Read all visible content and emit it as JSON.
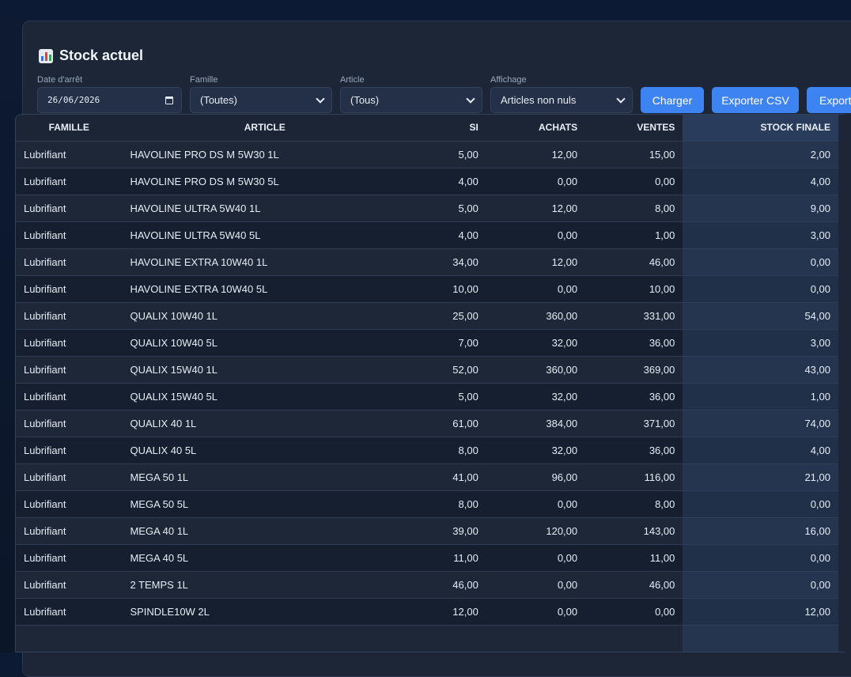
{
  "page": {
    "title": "Stock actuel",
    "title_icon": "bar-chart-icon"
  },
  "filters": {
    "date_label": "Date d'arrêt",
    "date_value": "26/06/2026",
    "famille_label": "Famille",
    "famille_value": "(Toutes)",
    "article_label": "Article",
    "article_value": "(Tous)",
    "affichage_label": "Affichage",
    "affichage_value": "Articles non nuls"
  },
  "buttons": {
    "charger": "Charger",
    "export_csv": "Exporter CSV",
    "export_other": "Exporte"
  },
  "colors": {
    "accent": "#3d84f2",
    "panel": "#1c2636",
    "highlight_column": "#25354f"
  },
  "table": {
    "headers": [
      "FAMILLE",
      "ARTICLE",
      "SI",
      "ACHATS",
      "VENTES",
      "STOCK FINALE"
    ],
    "rows": [
      [
        "Lubrifiant",
        "HAVOLINE PRO DS M 5W30 1L",
        "5,00",
        "12,00",
        "15,00",
        "2,00"
      ],
      [
        "Lubrifiant",
        "HAVOLINE PRO DS M 5W30 5L",
        "4,00",
        "0,00",
        "0,00",
        "4,00"
      ],
      [
        "Lubrifiant",
        "HAVOLINE ULTRA 5W40 1L",
        "5,00",
        "12,00",
        "8,00",
        "9,00"
      ],
      [
        "Lubrifiant",
        "HAVOLINE ULTRA 5W40 5L",
        "4,00",
        "0,00",
        "1,00",
        "3,00"
      ],
      [
        "Lubrifiant",
        "HAVOLINE EXTRA 10W40 1L",
        "34,00",
        "12,00",
        "46,00",
        "0,00"
      ],
      [
        "Lubrifiant",
        "HAVOLINE EXTRA 10W40 5L",
        "10,00",
        "0,00",
        "10,00",
        "0,00"
      ],
      [
        "Lubrifiant",
        "QUALIX 10W40 1L",
        "25,00",
        "360,00",
        "331,00",
        "54,00"
      ],
      [
        "Lubrifiant",
        "QUALIX 10W40 5L",
        "7,00",
        "32,00",
        "36,00",
        "3,00"
      ],
      [
        "Lubrifiant",
        "QUALIX 15W40 1L",
        "52,00",
        "360,00",
        "369,00",
        "43,00"
      ],
      [
        "Lubrifiant",
        "QUALIX 15W40 5L",
        "5,00",
        "32,00",
        "36,00",
        "1,00"
      ],
      [
        "Lubrifiant",
        "QUALIX 40 1L",
        "61,00",
        "384,00",
        "371,00",
        "74,00"
      ],
      [
        "Lubrifiant",
        "QUALIX 40 5L",
        "8,00",
        "32,00",
        "36,00",
        "4,00"
      ],
      [
        "Lubrifiant",
        "MEGA 50 1L",
        "41,00",
        "96,00",
        "116,00",
        "21,00"
      ],
      [
        "Lubrifiant",
        "MEGA 50 5L",
        "8,00",
        "0,00",
        "8,00",
        "0,00"
      ],
      [
        "Lubrifiant",
        "MEGA 40 1L",
        "39,00",
        "120,00",
        "143,00",
        "16,00"
      ],
      [
        "Lubrifiant",
        "MEGA 40 5L",
        "11,00",
        "0,00",
        "11,00",
        "0,00"
      ],
      [
        "Lubrifiant",
        "2 TEMPS 1L",
        "46,00",
        "0,00",
        "46,00",
        "0,00"
      ],
      [
        "Lubrifiant",
        "SPINDLE10W 2L",
        "12,00",
        "0,00",
        "0,00",
        "12,00"
      ],
      [
        "",
        "",
        "",
        "",
        "",
        ""
      ]
    ]
  }
}
